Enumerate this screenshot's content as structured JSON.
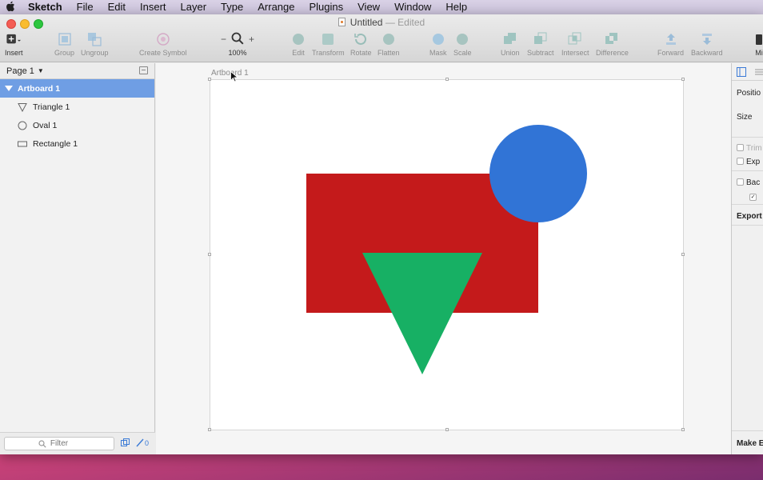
{
  "menubar": {
    "app_name": "Sketch",
    "items": [
      "File",
      "Edit",
      "Insert",
      "Layer",
      "Type",
      "Arrange",
      "Plugins",
      "View",
      "Window",
      "Help"
    ]
  },
  "window": {
    "title": "Untitled",
    "title_status": "— Edited"
  },
  "toolbar": {
    "insert": "Insert",
    "group": "Group",
    "ungroup": "Ungroup",
    "create_symbol": "Create Symbol",
    "zoom_minus": "−",
    "zoom_plus": "+",
    "zoom_level": "100%",
    "edit": "Edit",
    "transform": "Transform",
    "rotate": "Rotate",
    "flatten": "Flatten",
    "mask": "Mask",
    "scale": "Scale",
    "union": "Union",
    "subtract": "Subtract",
    "intersect": "Intersect",
    "difference": "Difference",
    "forward": "Forward",
    "backward": "Backward",
    "mirror": "Mi"
  },
  "sidebar": {
    "page": "Page 1",
    "layers": [
      {
        "name": "Artboard 1",
        "icon": "artboard-expand-icon"
      },
      {
        "name": "Triangle 1",
        "icon": "triangle-icon"
      },
      {
        "name": "Oval 1",
        "icon": "oval-icon"
      },
      {
        "name": "Rectangle 1",
        "icon": "rectangle-icon"
      }
    ],
    "filter_placeholder": "Filter",
    "filter_count": "0"
  },
  "canvas": {
    "artboard_label": "Artboard 1",
    "shapes": {
      "rectangle_color": "#c41a1b",
      "oval_color": "#3174d6",
      "triangle_color": "#17b064"
    }
  },
  "inspector": {
    "position": "Positio",
    "size": "Size",
    "trim": "Trim",
    "exp": "Exp",
    "bac": "Bac",
    "export": "Export",
    "make": "Make E"
  },
  "colors": {
    "selection": "#6f9ee4",
    "close": "#f45d55",
    "minimize": "#f9bc2f",
    "maximize": "#2dc63f"
  }
}
